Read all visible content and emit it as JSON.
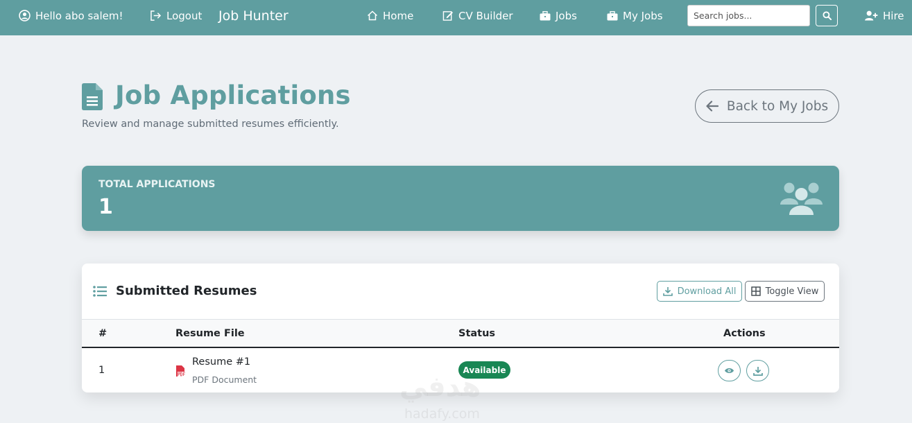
{
  "navbar": {
    "greeting": "Hello abo salem!",
    "logout": "Logout",
    "brand": "Job Hunter",
    "home": "Home",
    "cv_builder": "CV Builder",
    "jobs": "Jobs",
    "my_jobs": "My Jobs",
    "search_placeholder": "Search jobs...",
    "hire": "Hire"
  },
  "header": {
    "title": "Job Applications",
    "subtitle": "Review and manage submitted resumes efficiently.",
    "back_label": "Back to My Jobs"
  },
  "stats": {
    "label": "TOTAL APPLICATIONS",
    "value": "1"
  },
  "resumes": {
    "title": "Submitted Resumes",
    "download_all": "Download All",
    "toggle_view": "Toggle View",
    "columns": [
      "#",
      "Resume File",
      "Status",
      "Actions"
    ],
    "rows": [
      {
        "num": "1",
        "file_name": "Resume #1",
        "file_type": "PDF Document",
        "status": "Available"
      }
    ]
  },
  "watermark": {
    "brand": "هدفي",
    "url": "hadafy.com"
  },
  "colors": {
    "accent": "#5f9ea0",
    "success": "#198754",
    "background": "#eef1f4"
  }
}
